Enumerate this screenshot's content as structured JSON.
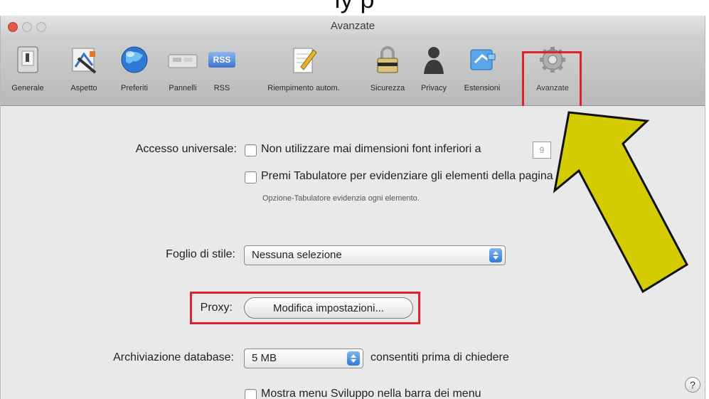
{
  "window": {
    "title": "Avanzate"
  },
  "toolbar": {
    "items": [
      {
        "label": "Generale",
        "icon": "general-icon"
      },
      {
        "label": "Aspetto",
        "icon": "appearance-icon"
      },
      {
        "label": "Preferiti",
        "icon": "bookmarks-globe-icon"
      },
      {
        "label": "Pannelli",
        "icon": "tabs-icon"
      },
      {
        "label": "RSS",
        "icon": "rss-icon"
      },
      {
        "label": "Riempimento autom.",
        "icon": "autofill-pencil-icon"
      },
      {
        "label": "Sicurezza",
        "icon": "lock-icon"
      },
      {
        "label": "Privacy",
        "icon": "privacy-person-icon"
      },
      {
        "label": "Estensioni",
        "icon": "extensions-icon"
      },
      {
        "label": "Avanzate",
        "icon": "gear-icon"
      }
    ],
    "rss_badge": "RSS",
    "selected": "Avanzate"
  },
  "settings": {
    "universal_access_label": "Accesso universale:",
    "never_use_small_fonts": "Non utilizzare mai dimensioni font inferiori a",
    "font_size_value": "9",
    "tab_highlight": "Premi Tabulatore per evidenziare gli elementi della pagina",
    "tab_hint": "Opzione-Tabulatore evidenzia ogni elemento.",
    "stylesheet_label": "Foglio di stile:",
    "stylesheet_value": "Nessuna selezione",
    "proxy_label": "Proxy:",
    "proxy_button": "Modifica impostazioni...",
    "database_label": "Archiviazione database:",
    "database_value": "5 MB",
    "database_suffix": "consentiti prima di chiedere",
    "develop_menu": "Mostra menu Sviluppo nella barra dei menu"
  },
  "help_label": "?",
  "colors": {
    "highlight": "#e0202a",
    "arrow": "#d4cc00"
  },
  "top_caption": "ly                         p"
}
